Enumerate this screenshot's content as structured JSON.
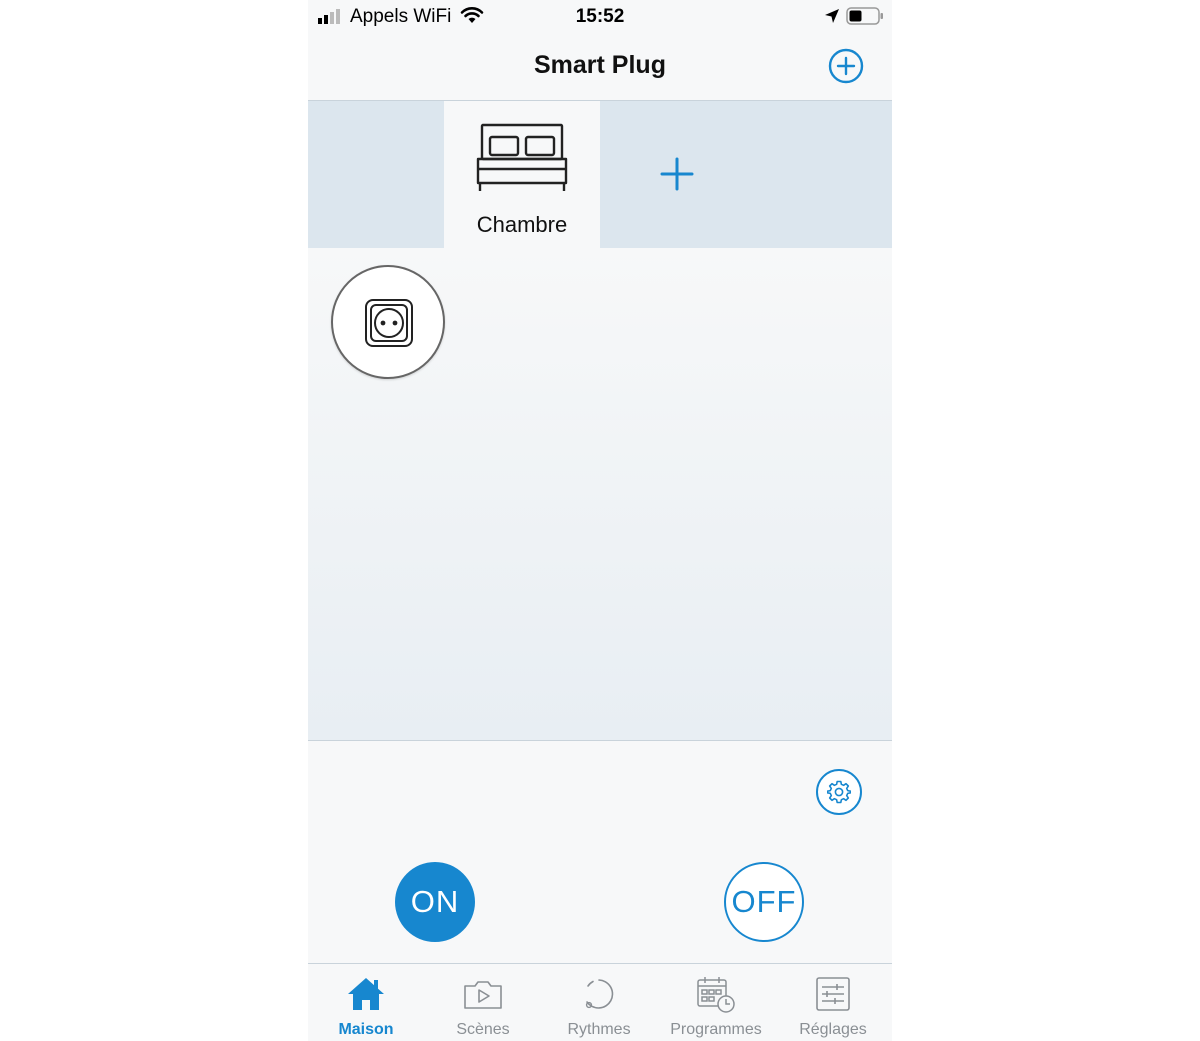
{
  "status_bar": {
    "carrier": "Appels WiFi",
    "time": "15:52"
  },
  "nav": {
    "title": "Smart Plug",
    "add_icon": "plus-circle-icon"
  },
  "rooms": [
    {
      "label": "Chambre",
      "icon": "bed-icon",
      "selected": true
    }
  ],
  "controls": {
    "on_label": "ON",
    "off_label": "OFF",
    "settings_icon": "gear-icon"
  },
  "tabs": [
    {
      "label": "Maison",
      "icon": "home-icon",
      "active": true
    },
    {
      "label": "Scènes",
      "icon": "scene-camera-icon",
      "active": false
    },
    {
      "label": "Rythmes",
      "icon": "rhythm-icon",
      "active": false
    },
    {
      "label": "Programmes",
      "icon": "calendar-clock-icon",
      "active": false
    },
    {
      "label": "Réglages",
      "icon": "sliders-icon",
      "active": false
    }
  ],
  "colors": {
    "accent": "#1787cf",
    "room_strip": "#dce6ee",
    "inactive_tab": "#8a8f94"
  }
}
